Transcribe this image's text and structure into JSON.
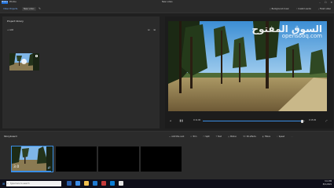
{
  "window": {
    "app_name": "Photos",
    "doc_title": "New video",
    "controls": [
      "–",
      "☐",
      "✕"
    ]
  },
  "commandbar": {
    "back_label": "Video Projects",
    "active_label": "New video",
    "pen_icon": "✎",
    "tools": [
      {
        "icon": "♫",
        "label": "Background music"
      },
      {
        "icon": "♪",
        "label": "Custom audio"
      },
      {
        "icon": "⤓",
        "label": "Finish video"
      }
    ]
  },
  "library": {
    "title": "Project library",
    "add_label": "+ Add",
    "view_icons": [
      "⊟",
      "⊞"
    ]
  },
  "player": {
    "watermark_ar": "السوق المفتوح",
    "watermark_lat": "opensooq.com",
    "prev": "◂",
    "play": "❚❚",
    "time_current": "0:11.00",
    "time_total": "0:15.00",
    "fullscreen": "⤢",
    "progress": 0.97
  },
  "storyboard": {
    "title": "Storyboard",
    "tools": [
      {
        "icon": "▭",
        "label": "Add title card"
      },
      {
        "icon": "⊡",
        "label": "Trim"
      },
      {
        "icon": "⊓",
        "label": "Split"
      },
      {
        "icon": "T",
        "label": "Text"
      },
      {
        "icon": "◎",
        "label": "Motion"
      },
      {
        "icon": "3D",
        "label": "3D effects"
      },
      {
        "icon": "◐",
        "label": "Filters"
      },
      {
        "icon": "⚡",
        "label": "Speed"
      },
      {
        "icon": "⋯",
        "label": ""
      }
    ],
    "cards": [
      {
        "duration": "3.0",
        "speaker": "🔊"
      },
      {
        "duration": ""
      },
      {
        "duration": ""
      },
      {
        "duration": ""
      }
    ]
  },
  "taskbar": {
    "start_icon": "⊞",
    "search_placeholder": "Type here to search",
    "tray_time": "3:11 PM",
    "tray_date": "8/11/2021"
  }
}
